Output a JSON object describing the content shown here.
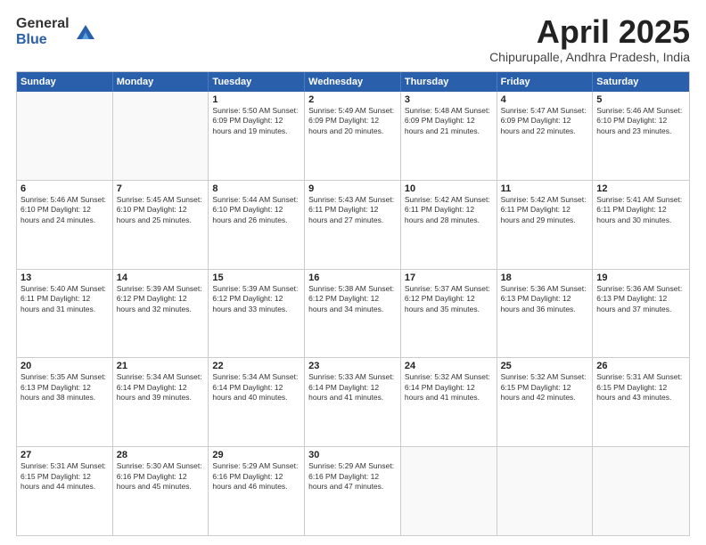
{
  "header": {
    "logo_general": "General",
    "logo_blue": "Blue",
    "month_title": "April 2025",
    "subtitle": "Chipurupalle, Andhra Pradesh, India"
  },
  "weekdays": [
    "Sunday",
    "Monday",
    "Tuesday",
    "Wednesday",
    "Thursday",
    "Friday",
    "Saturday"
  ],
  "weeks": [
    [
      {
        "day": "",
        "info": ""
      },
      {
        "day": "",
        "info": ""
      },
      {
        "day": "1",
        "info": "Sunrise: 5:50 AM\nSunset: 6:09 PM\nDaylight: 12 hours and 19 minutes."
      },
      {
        "day": "2",
        "info": "Sunrise: 5:49 AM\nSunset: 6:09 PM\nDaylight: 12 hours and 20 minutes."
      },
      {
        "day": "3",
        "info": "Sunrise: 5:48 AM\nSunset: 6:09 PM\nDaylight: 12 hours and 21 minutes."
      },
      {
        "day": "4",
        "info": "Sunrise: 5:47 AM\nSunset: 6:09 PM\nDaylight: 12 hours and 22 minutes."
      },
      {
        "day": "5",
        "info": "Sunrise: 5:46 AM\nSunset: 6:10 PM\nDaylight: 12 hours and 23 minutes."
      }
    ],
    [
      {
        "day": "6",
        "info": "Sunrise: 5:46 AM\nSunset: 6:10 PM\nDaylight: 12 hours and 24 minutes."
      },
      {
        "day": "7",
        "info": "Sunrise: 5:45 AM\nSunset: 6:10 PM\nDaylight: 12 hours and 25 minutes."
      },
      {
        "day": "8",
        "info": "Sunrise: 5:44 AM\nSunset: 6:10 PM\nDaylight: 12 hours and 26 minutes."
      },
      {
        "day": "9",
        "info": "Sunrise: 5:43 AM\nSunset: 6:11 PM\nDaylight: 12 hours and 27 minutes."
      },
      {
        "day": "10",
        "info": "Sunrise: 5:42 AM\nSunset: 6:11 PM\nDaylight: 12 hours and 28 minutes."
      },
      {
        "day": "11",
        "info": "Sunrise: 5:42 AM\nSunset: 6:11 PM\nDaylight: 12 hours and 29 minutes."
      },
      {
        "day": "12",
        "info": "Sunrise: 5:41 AM\nSunset: 6:11 PM\nDaylight: 12 hours and 30 minutes."
      }
    ],
    [
      {
        "day": "13",
        "info": "Sunrise: 5:40 AM\nSunset: 6:11 PM\nDaylight: 12 hours and 31 minutes."
      },
      {
        "day": "14",
        "info": "Sunrise: 5:39 AM\nSunset: 6:12 PM\nDaylight: 12 hours and 32 minutes."
      },
      {
        "day": "15",
        "info": "Sunrise: 5:39 AM\nSunset: 6:12 PM\nDaylight: 12 hours and 33 minutes."
      },
      {
        "day": "16",
        "info": "Sunrise: 5:38 AM\nSunset: 6:12 PM\nDaylight: 12 hours and 34 minutes."
      },
      {
        "day": "17",
        "info": "Sunrise: 5:37 AM\nSunset: 6:12 PM\nDaylight: 12 hours and 35 minutes."
      },
      {
        "day": "18",
        "info": "Sunrise: 5:36 AM\nSunset: 6:13 PM\nDaylight: 12 hours and 36 minutes."
      },
      {
        "day": "19",
        "info": "Sunrise: 5:36 AM\nSunset: 6:13 PM\nDaylight: 12 hours and 37 minutes."
      }
    ],
    [
      {
        "day": "20",
        "info": "Sunrise: 5:35 AM\nSunset: 6:13 PM\nDaylight: 12 hours and 38 minutes."
      },
      {
        "day": "21",
        "info": "Sunrise: 5:34 AM\nSunset: 6:14 PM\nDaylight: 12 hours and 39 minutes."
      },
      {
        "day": "22",
        "info": "Sunrise: 5:34 AM\nSunset: 6:14 PM\nDaylight: 12 hours and 40 minutes."
      },
      {
        "day": "23",
        "info": "Sunrise: 5:33 AM\nSunset: 6:14 PM\nDaylight: 12 hours and 41 minutes."
      },
      {
        "day": "24",
        "info": "Sunrise: 5:32 AM\nSunset: 6:14 PM\nDaylight: 12 hours and 41 minutes."
      },
      {
        "day": "25",
        "info": "Sunrise: 5:32 AM\nSunset: 6:15 PM\nDaylight: 12 hours and 42 minutes."
      },
      {
        "day": "26",
        "info": "Sunrise: 5:31 AM\nSunset: 6:15 PM\nDaylight: 12 hours and 43 minutes."
      }
    ],
    [
      {
        "day": "27",
        "info": "Sunrise: 5:31 AM\nSunset: 6:15 PM\nDaylight: 12 hours and 44 minutes."
      },
      {
        "day": "28",
        "info": "Sunrise: 5:30 AM\nSunset: 6:16 PM\nDaylight: 12 hours and 45 minutes."
      },
      {
        "day": "29",
        "info": "Sunrise: 5:29 AM\nSunset: 6:16 PM\nDaylight: 12 hours and 46 minutes."
      },
      {
        "day": "30",
        "info": "Sunrise: 5:29 AM\nSunset: 6:16 PM\nDaylight: 12 hours and 47 minutes."
      },
      {
        "day": "",
        "info": ""
      },
      {
        "day": "",
        "info": ""
      },
      {
        "day": "",
        "info": ""
      }
    ]
  ]
}
